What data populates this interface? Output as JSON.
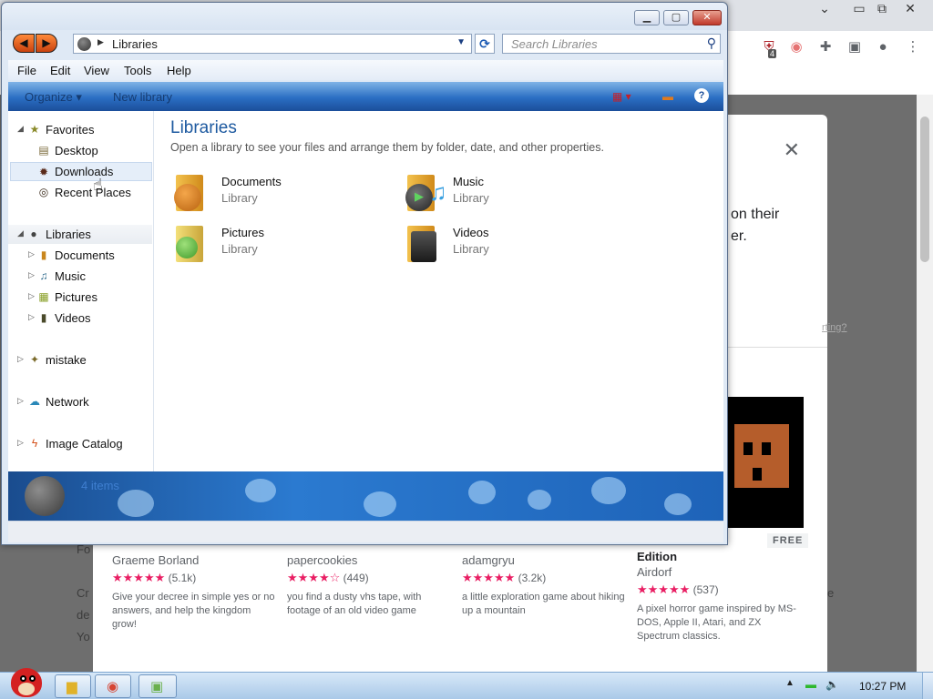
{
  "explorer": {
    "address": "Libraries",
    "search_placeholder": "Search Libraries",
    "menu": [
      "File",
      "Edit",
      "View",
      "Tools",
      "Help"
    ],
    "cmdbar": {
      "organize": "Organize",
      "new_library": "New library",
      "help": "?"
    },
    "nav": {
      "favorites": "Favorites",
      "desktop": "Desktop",
      "downloads": "Downloads",
      "recent": "Recent Places",
      "libraries": "Libraries",
      "lib_documents": "Documents",
      "lib_music": "Music",
      "lib_pictures": "Pictures",
      "lib_videos": "Videos",
      "mistake": "mistake",
      "network": "Network",
      "image_catalog": "Image Catalog"
    },
    "content": {
      "heading": "Libraries",
      "subtitle": "Open a library to see your files and arrange them by folder, date, and other properties.",
      "libraries": [
        {
          "name": "Documents",
          "kind": "Library"
        },
        {
          "name": "Music",
          "kind": "Library"
        },
        {
          "name": "Pictures",
          "kind": "Library"
        },
        {
          "name": "Videos",
          "kind": "Library"
        }
      ]
    },
    "details": {
      "count": "4 items"
    }
  },
  "browser": {
    "dialog_text": "on their\ner.",
    "link_text": "rting?",
    "badge": "FREE",
    "ghost_fo": "Fo",
    "ghost_cr": "Cr",
    "ghost_de": "de",
    "ghost_yo": "Yo",
    "ghost_e": "e",
    "ext_badge": "4",
    "cards": [
      {
        "title": "",
        "author": "Graeme Borland",
        "stars": "★★★★★",
        "count": "(5.1k)",
        "desc": "Give your decree in simple yes or no answers, and help the kingdom grow!"
      },
      {
        "title": "",
        "author": "papercookies",
        "stars": "★★★★☆",
        "count": "(449)",
        "desc": "you find a dusty vhs tape, with footage of an old video game"
      },
      {
        "title": "",
        "author": "adamgryu",
        "stars": "★★★★★",
        "count": "(3.2k)",
        "desc": "a little exploration game about hiking up a mountain"
      },
      {
        "title": "Edition",
        "author": "Airdorf",
        "stars": "★★★★★",
        "count": "(537)",
        "desc": "A pixel horror game inspired by MS-DOS, Apple II, Atari, and ZX Spectrum classics."
      }
    ]
  },
  "taskbar": {
    "clock": "10:27 PM"
  }
}
